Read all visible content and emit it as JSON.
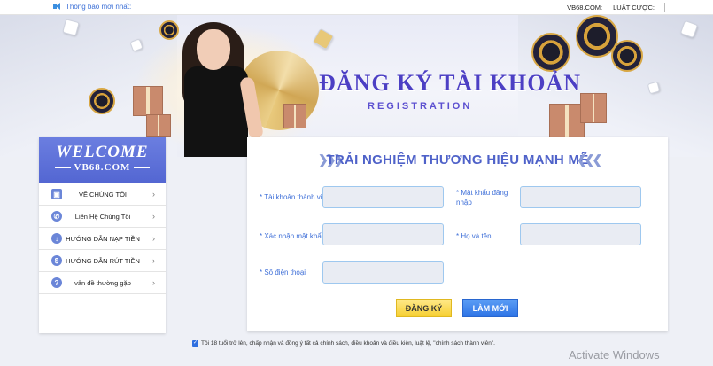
{
  "topbar": {
    "notice": "Thông báo mới nhất:",
    "links": [
      "VB68.COM:",
      "LUẬT CƯỢC:"
    ]
  },
  "hero": {
    "title": "ĐĂNG KÝ TÀI KHOẢN",
    "subtitle": "REGISTRATION"
  },
  "sidebar": {
    "welcome": "WELCOME",
    "site": "VB68.COM",
    "items": [
      {
        "label": "VỀ CHÚNG TÔI",
        "icon": "person-card-icon"
      },
      {
        "label": "Liên Hệ Chúng Tôi",
        "icon": "phone-icon"
      },
      {
        "label": "HƯỚNG DẪN NẠP TIỀN",
        "icon": "deposit-icon"
      },
      {
        "label": "HƯỚNG DẪN RÚT TIỀN",
        "icon": "dollar-icon"
      },
      {
        "label": "vấn đề thường gặp",
        "icon": "question-icon"
      }
    ]
  },
  "form": {
    "title": "TRẢI NGHIỆM THƯƠNG HIỆU MẠNH MẼ",
    "fields": {
      "username": "* Tài khoản thành viên",
      "password": "* Mật khẩu đăng nhập",
      "confirm": "* Xác nhận mật khẩu",
      "fullname": "* Họ và tên",
      "phone": "* Số điện thoại"
    },
    "register_btn": "ĐĂNG KÝ",
    "reset_btn": "LÀM MỚI"
  },
  "agreement": "Tôi 18 tuổi trở lên, chấp nhận và đồng ý tất cả chính sách, điều khoản và điều kiện, luật lệ, \"chính sách thành viên\".",
  "watermark": "Activate Windows",
  "colors": {
    "brand": "#5366d2",
    "accent_yellow": "#f6cf32",
    "accent_blue": "#2e74e6",
    "label_blue": "#3e6fd8"
  }
}
